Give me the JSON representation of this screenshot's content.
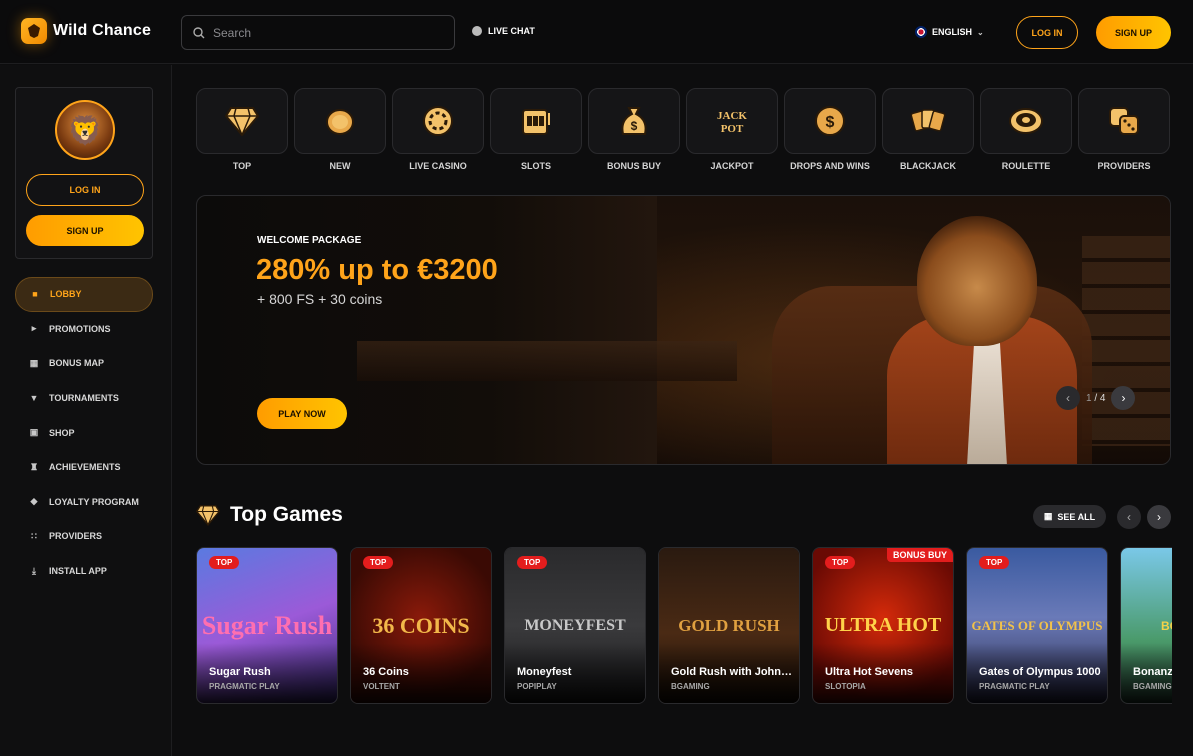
{
  "brand": {
    "name": "Wild Chance"
  },
  "header": {
    "search_placeholder": "Search",
    "live_chat": "LIVE CHAT",
    "language": "ENGLISH",
    "login": "LOG IN",
    "signup": "SIGN UP"
  },
  "sidebar": {
    "login": "LOG IN",
    "signup": "SIGN UP",
    "items": [
      {
        "label": "LOBBY",
        "icon": "cube-icon",
        "active": true
      },
      {
        "label": "PROMOTIONS",
        "icon": "megaphone-icon"
      },
      {
        "label": "BONUS MAP",
        "icon": "map-icon"
      },
      {
        "label": "TOURNAMENTS",
        "icon": "trophy-icon"
      },
      {
        "label": "SHOP",
        "icon": "shop-icon"
      },
      {
        "label": "ACHIEVEMENTS",
        "icon": "crown-icon"
      },
      {
        "label": "LOYALTY PROGRAM",
        "icon": "diamond-icon"
      },
      {
        "label": "PROVIDERS",
        "icon": "grid-icon"
      },
      {
        "label": "INSTALL APP",
        "icon": "download-icon"
      }
    ]
  },
  "categories": [
    {
      "label": "TOP",
      "icon": "diamond-icon"
    },
    {
      "label": "NEW",
      "icon": "coin-icon"
    },
    {
      "label": "LIVE CASINO",
      "icon": "chip-icon"
    },
    {
      "label": "SLOTS",
      "icon": "slot-machine-icon"
    },
    {
      "label": "BONUS BUY",
      "icon": "money-bag-icon"
    },
    {
      "label": "JACKPOT",
      "icon": "jackpot-icon"
    },
    {
      "label": "DROPS AND WINS",
      "icon": "dollar-coin-icon"
    },
    {
      "label": "BLACKJACK",
      "icon": "cards-icon"
    },
    {
      "label": "ROULETTE",
      "icon": "roulette-icon"
    },
    {
      "label": "PROVIDERS",
      "icon": "dice-icon"
    }
  ],
  "hero": {
    "kicker": "WELCOME PACKAGE",
    "title": "280% up to €3200",
    "subtitle": "+ 800 FS + 30 coins",
    "cta": "PLAY NOW",
    "page_current": "1",
    "page_total": "4"
  },
  "top_games": {
    "title": "Top Games",
    "see_all": "SEE ALL",
    "games": [
      {
        "name": "Sugar Rush",
        "provider": "PRAGMATIC PLAY",
        "badge": "TOP",
        "art": "Sugar Rush"
      },
      {
        "name": "36 Coins",
        "provider": "VOLTENT",
        "badge": "TOP",
        "art": "36 COINS"
      },
      {
        "name": "Moneyfest",
        "provider": "POPIPLAY",
        "badge": "TOP",
        "art": "MONEYFEST"
      },
      {
        "name": "Gold Rush with Johnn...",
        "provider": "BGAMING",
        "badge": "",
        "art": "GOLD RUSH"
      },
      {
        "name": "Ultra Hot Sevens",
        "provider": "SLOTOPIA",
        "badge": "TOP",
        "ribbon": "BONUS BUY",
        "art": "ULTRA HOT"
      },
      {
        "name": "Gates of Olympus 1000",
        "provider": "PRAGMATIC PLAY",
        "badge": "TOP",
        "art": "GATES OF OLYMPUS"
      },
      {
        "name": "Bonanza",
        "provider": "BGAMING",
        "badge": "",
        "art": "BONANZA"
      }
    ]
  }
}
